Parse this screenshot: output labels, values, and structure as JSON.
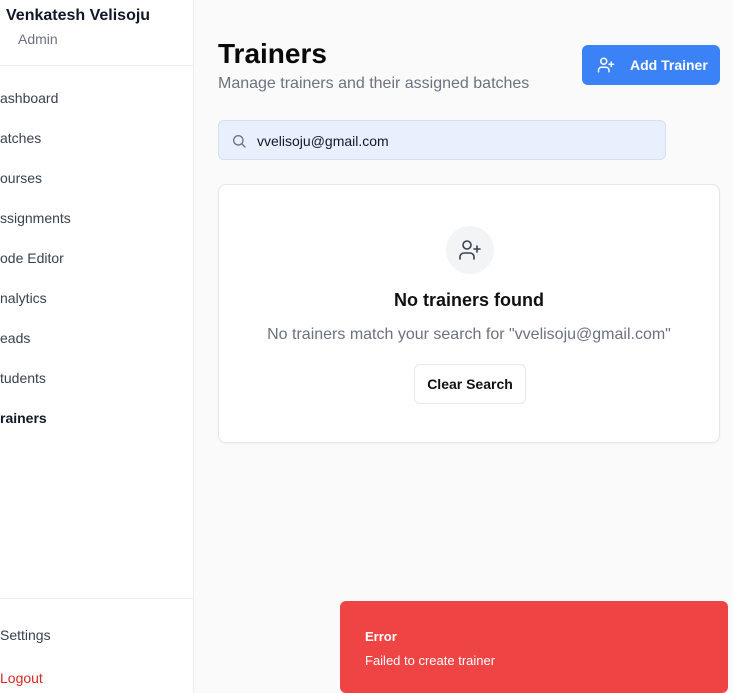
{
  "user": {
    "name": "Venkatesh Velisoju",
    "role": "Admin"
  },
  "sidebar": {
    "items": [
      {
        "label": "ashboard"
      },
      {
        "label": "atches"
      },
      {
        "label": "ourses"
      },
      {
        "label": "ssignments"
      },
      {
        "label": "ode Editor"
      },
      {
        "label": "nalytics"
      },
      {
        "label": "eads"
      },
      {
        "label": "tudents"
      },
      {
        "label": "rainers"
      }
    ],
    "settings_label": "Settings",
    "logout_label": "Logout"
  },
  "header": {
    "title": "Trainers",
    "subtitle": "Manage trainers and their assigned batches",
    "add_button_label": "Add Trainer"
  },
  "search": {
    "value": "vvelisoju@gmail.com"
  },
  "empty_state": {
    "title": "No trainers found",
    "description": "No trainers match your search for \"vvelisoju@gmail.com\"",
    "clear_button_label": "Clear Search"
  },
  "toast": {
    "title": "Error",
    "description": "Failed to create trainer"
  },
  "colors": {
    "accent": "#3b82f6",
    "error": "#ef4444",
    "logout": "#dc2626"
  }
}
